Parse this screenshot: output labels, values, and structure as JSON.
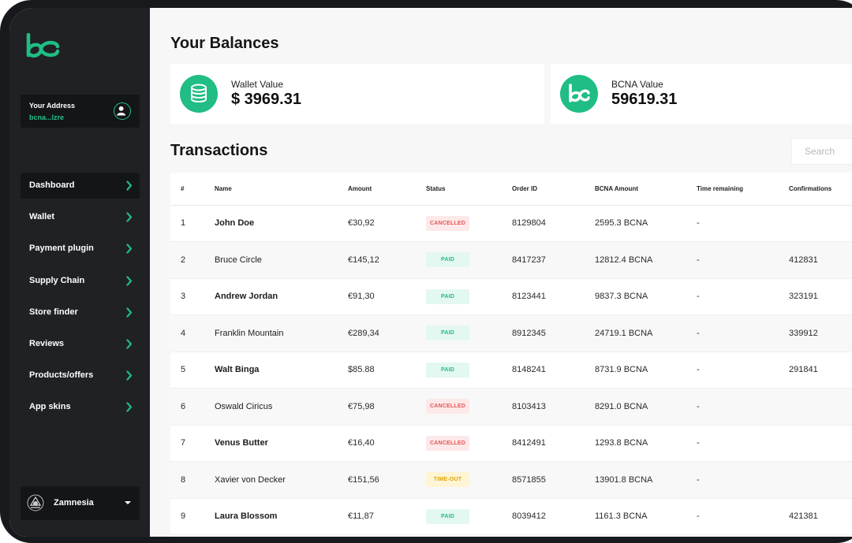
{
  "colors": {
    "accent": "#20bd84",
    "sidebar_bg": "#202124",
    "cancelled_bg": "#fde9e9",
    "cancelled_fg": "#e25757",
    "paid_bg": "#e3f8f0",
    "paid_fg": "#28b981",
    "timeout_bg": "#fff4d4",
    "timeout_fg": "#e0a600"
  },
  "sidebar": {
    "logo_icon": "bc-logo-icon",
    "address": {
      "label": "Your Address",
      "value": "bcna...lzre",
      "icon": "user-icon"
    },
    "items": [
      {
        "label": "Dashboard",
        "active": true
      },
      {
        "label": "Wallet"
      },
      {
        "label": "Payment plugin"
      },
      {
        "label": "Supply Chain"
      },
      {
        "label": "Store finder"
      },
      {
        "label": "Reviews"
      },
      {
        "label": "Products/offers"
      },
      {
        "label": "App skins"
      }
    ],
    "profile": {
      "name": "Zamnesia",
      "avatar_icon": "zamnesia-avatar-icon"
    }
  },
  "balances": {
    "title": "Your Balances",
    "cards": [
      {
        "label": "Wallet Value",
        "value": "$ 3969.31",
        "icon": "coins-icon"
      },
      {
        "label": "BCNA Value",
        "value": "59619.31",
        "icon": "bcna-icon"
      }
    ]
  },
  "transactions": {
    "title": "Transactions",
    "search_placeholder": "Search",
    "columns": [
      "#",
      "Name",
      "Amount",
      "Status",
      "Order ID",
      "BCNA Amount",
      "Time remaining",
      "Confirmations"
    ],
    "rows": [
      {
        "num": "1",
        "name": "John Doe",
        "amount": "€30,92",
        "status": "CANCELLED",
        "status_type": "cancelled",
        "order_id": "8129804",
        "bcna": "2595.3 BCNA",
        "time": "-",
        "conf": ""
      },
      {
        "num": "2",
        "name": "Bruce Circle",
        "amount": "€145,12",
        "status": "PAID",
        "status_type": "paid",
        "order_id": "8417237",
        "bcna": "12812.4 BCNA",
        "time": "-",
        "conf": "412831"
      },
      {
        "num": "3",
        "name": "Andrew Jordan",
        "amount": "€91,30",
        "status": "PAID",
        "status_type": "paid",
        "order_id": "8123441",
        "bcna": "9837.3 BCNA",
        "time": "-",
        "conf": "323191"
      },
      {
        "num": "4",
        "name": "Franklin Mountain",
        "amount": "€289,34",
        "status": "PAID",
        "status_type": "paid",
        "order_id": "8912345",
        "bcna": "24719.1 BCNA",
        "time": "-",
        "conf": "339912"
      },
      {
        "num": "5",
        "name": "Walt Binga",
        "amount": "$85.88",
        "status": "PAID",
        "status_type": "paid",
        "order_id": "8148241",
        "bcna": "8731.9 BCNA",
        "time": "-",
        "conf": "291841"
      },
      {
        "num": "6",
        "name": "Oswald Ciricus",
        "amount": "€75,98",
        "status": "CANCELLED",
        "status_type": "cancelled",
        "order_id": "8103413",
        "bcna": "8291.0 BCNA",
        "time": "-",
        "conf": ""
      },
      {
        "num": "7",
        "name": "Venus Butter",
        "amount": "€16,40",
        "status": "CANCELLED",
        "status_type": "cancelled",
        "order_id": "8412491",
        "bcna": "1293.8 BCNA",
        "time": "-",
        "conf": ""
      },
      {
        "num": "8",
        "name": "Xavier von Decker",
        "amount": "€151,56",
        "status": "TIME-OUT",
        "status_type": "timeout",
        "order_id": "8571855",
        "bcna": "13901.8 BCNA",
        "time": "-",
        "conf": ""
      },
      {
        "num": "9",
        "name": "Laura Blossom",
        "amount": "€11,87",
        "status": "PAID",
        "status_type": "paid",
        "order_id": "8039412",
        "bcna": "1161.3 BCNA",
        "time": "-",
        "conf": "421381"
      }
    ]
  }
}
